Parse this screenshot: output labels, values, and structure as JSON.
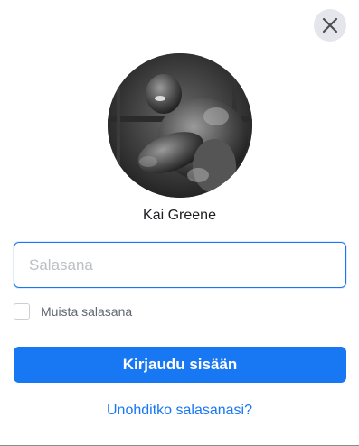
{
  "dialog": {
    "close_icon": "close-icon",
    "profile": {
      "name": "Kai Greene",
      "avatar_icon": "profile-photo"
    },
    "password_field": {
      "value": "",
      "placeholder": "Salasana"
    },
    "remember": {
      "label": "Muista salasana",
      "checked": false
    },
    "login_button": {
      "label": "Kirjaudu sisään"
    },
    "forgot_link": {
      "label": "Unohditko salasanasi?"
    },
    "colors": {
      "accent": "#1877f2",
      "close_bg": "#e4e6eb",
      "text": "#1c1e21",
      "muted": "#606770"
    }
  }
}
